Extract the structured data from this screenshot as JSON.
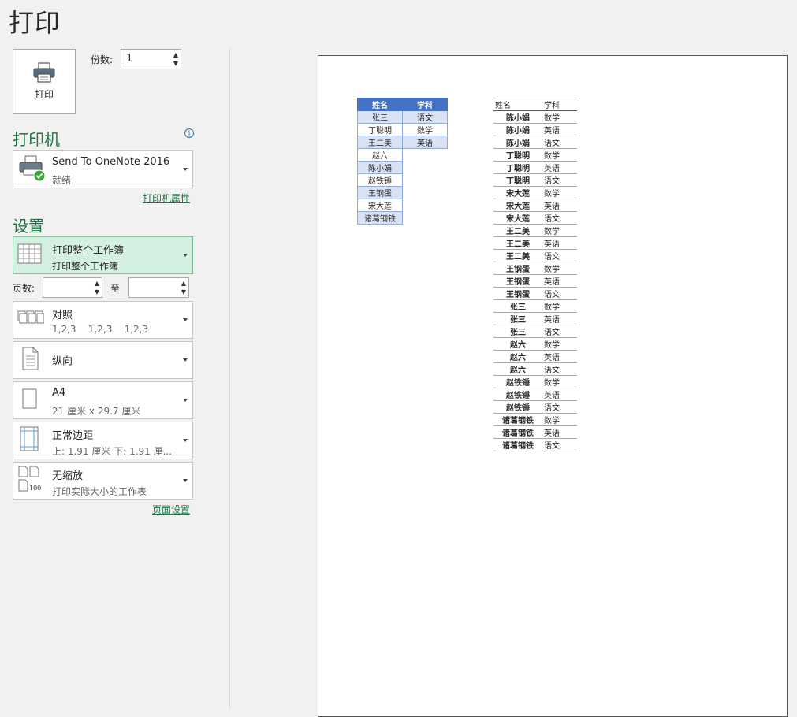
{
  "title": "打印",
  "print_button": {
    "label": "打印",
    "icon": "printer-icon"
  },
  "copies": {
    "label": "份数:",
    "value": "1"
  },
  "printer_section": {
    "heading": "打印机",
    "selected": {
      "name": "Send To OneNote 2016",
      "status": "就绪",
      "icon": "printer-ready-icon"
    },
    "properties_link": "打印机属性"
  },
  "settings_section": {
    "heading": "设置",
    "print_what": {
      "line1": "打印整个工作簿",
      "line2": "打印整个工作簿",
      "icon": "workbook-icon"
    },
    "pages": {
      "label": "页数:",
      "to_label": "至",
      "from": "",
      "to": ""
    },
    "collation": {
      "line1": "对照",
      "line2": "1,2,3    1,2,3    1,2,3",
      "icon": "collate-icon"
    },
    "orientation": {
      "line1": "纵向",
      "icon": "portrait-icon"
    },
    "paper": {
      "line1": "A4",
      "line2": "21 厘米 x 29.7 厘米",
      "icon": "paper-size-icon"
    },
    "margins": {
      "line1": "正常边距",
      "line2": "上: 1.91 厘米 下: 1.91 厘...",
      "icon": "margins-icon"
    },
    "scaling": {
      "line1": "无缩放",
      "line2": "打印实际大小的工作表",
      "icon": "no-scaling-icon"
    },
    "page_setup_link": "页面设置"
  },
  "preview": {
    "table1": {
      "headers": [
        "姓名",
        "学科"
      ],
      "rows": [
        [
          "张三",
          "语文"
        ],
        [
          "丁聪明",
          "数学"
        ],
        [
          "王二美",
          "英语"
        ],
        [
          "赵六",
          ""
        ],
        [
          "陈小娟",
          ""
        ],
        [
          "赵铁锤",
          ""
        ],
        [
          "王钢蛋",
          ""
        ],
        [
          "宋大莲",
          ""
        ],
        [
          "诸葛钢铁",
          ""
        ]
      ]
    },
    "table2": {
      "headers": [
        "姓名",
        "学科"
      ],
      "rows": [
        [
          "陈小娟",
          "数学"
        ],
        [
          "陈小娟",
          "英语"
        ],
        [
          "陈小娟",
          "语文"
        ],
        [
          "丁聪明",
          "数学"
        ],
        [
          "丁聪明",
          "英语"
        ],
        [
          "丁聪明",
          "语文"
        ],
        [
          "宋大莲",
          "数学"
        ],
        [
          "宋大莲",
          "英语"
        ],
        [
          "宋大莲",
          "语文"
        ],
        [
          "王二美",
          "数学"
        ],
        [
          "王二美",
          "英语"
        ],
        [
          "王二美",
          "语文"
        ],
        [
          "王钢蛋",
          "数学"
        ],
        [
          "王钢蛋",
          "英语"
        ],
        [
          "王钢蛋",
          "语文"
        ],
        [
          "张三",
          "数学"
        ],
        [
          "张三",
          "英语"
        ],
        [
          "张三",
          "语文"
        ],
        [
          "赵六",
          "数学"
        ],
        [
          "赵六",
          "英语"
        ],
        [
          "赵六",
          "语文"
        ],
        [
          "赵铁锤",
          "数学"
        ],
        [
          "赵铁锤",
          "英语"
        ],
        [
          "赵铁锤",
          "语文"
        ],
        [
          "诸葛钢铁",
          "数学"
        ],
        [
          "诸葛钢铁",
          "英语"
        ],
        [
          "诸葛钢铁",
          "语文"
        ]
      ]
    }
  },
  "colors": {
    "accent": "#217346",
    "selected_bg": "#d3f0e0",
    "table_header": "#4472c4",
    "table_band": "#d9e1f2"
  }
}
